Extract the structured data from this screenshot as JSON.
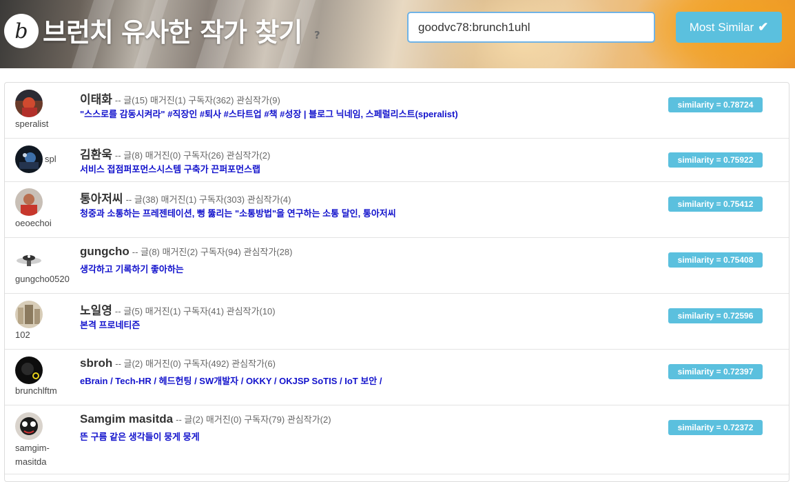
{
  "header": {
    "logo_letter": "b",
    "title": "브런치 유사한 작가 찾기",
    "help": "?",
    "search_value": "goodvc78:brunch1uhl",
    "button_label": "Most Similar",
    "button_icon": "✔"
  },
  "colors": {
    "accent": "#5bc0de",
    "link": "#1212cc",
    "input_border": "#6fb3e6"
  },
  "rows": [
    {
      "handle": "speralist",
      "name": "이태화",
      "stats": "-- 글(15) 매거진(1) 구독자(362) 관심작가(9)",
      "desc": "\"스스로를 감동시켜라\" #직장인 #퇴사 #스타트업 #책 #성장 | 블로그 닉네임, 스페럴리스트(speralist)",
      "similarity": "similarity = 0.78724"
    },
    {
      "handle": "spl",
      "name": "김환욱",
      "stats": "-- 글(8) 매거진(0) 구독자(26) 관심작가(2)",
      "desc": "서비스 접점퍼포먼스시스템 구축가 끈퍼포먼스랩",
      "similarity": "similarity = 0.75922"
    },
    {
      "handle": "oeoechoi",
      "name": "통아저씨",
      "stats": "-- 글(38) 매거진(1) 구독자(303) 관심작가(4)",
      "desc": "청중과 소통하는 프레젠테이션, 뻥 뚫리는 \"소통방법\"을 연구하는 소통 달인, 통아저씨",
      "similarity": "similarity = 0.75412"
    },
    {
      "handle": "gungcho0520",
      "name": "gungcho",
      "stats": "-- 글(8) 매거진(2) 구독자(94) 관심작가(28)",
      "desc": "생각하고 기록하기 좋아하는",
      "similarity": "similarity = 0.75408"
    },
    {
      "handle": "102",
      "name": "노일영",
      "stats": "-- 글(5) 매거진(1) 구독자(41) 관심작가(10)",
      "desc": "본격 프로네티즌",
      "similarity": "similarity = 0.72596"
    },
    {
      "handle": "brunchlftm",
      "name": "sbroh",
      "stats": "-- 글(2) 매거진(0) 구독자(492) 관심작가(6)",
      "desc": "eBrain / Tech-HR / 헤드헌팅 / SW개발자 / OKKY / OKJSP SoTIS / IoT 보안 /",
      "similarity": "similarity = 0.72397"
    },
    {
      "handle": "samgim-masitda",
      "name": "Samgim masitda",
      "stats": "-- 글(2) 매거진(0) 구독자(79) 관심작가(2)",
      "desc": "뜬 구름 같은 생각들이 뭉게 뭉게",
      "similarity": "similarity = 0.72372"
    }
  ]
}
